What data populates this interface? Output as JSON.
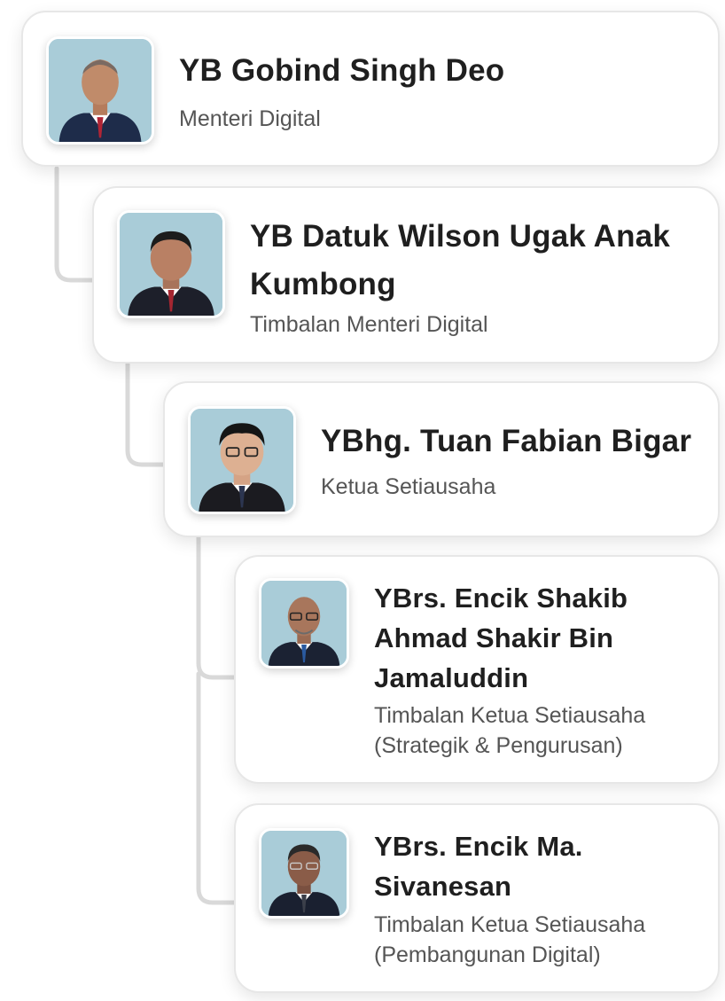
{
  "org_chart": [
    {
      "name": "YB Gobind Singh Deo",
      "role": "Menteri Digital",
      "avatar": "portrait-avatar"
    },
    {
      "name": "YB Datuk Wilson Ugak Anak Kumbong",
      "role": "Timbalan Menteri Digital",
      "avatar": "portrait-avatar"
    },
    {
      "name": "YBhg. Tuan Fabian Bigar",
      "role": "Ketua Setiausaha",
      "avatar": "portrait-avatar"
    },
    {
      "name": "YBrs. Encik Shakib Ahmad Shakir Bin Jamaluddin",
      "role": "Timbalan Ketua Setiausaha (Strategik & Pengurusan)",
      "avatar": "portrait-avatar"
    },
    {
      "name": "YBrs. Encik Ma. Sivanesan",
      "role": "Timbalan Ketua Setiausaha (Pembangunan Digital)",
      "avatar": "portrait-avatar"
    }
  ],
  "colors": {
    "photo_background": "#a9ccd8",
    "connector": "#d9d9d9",
    "card_border": "#e7e7e7"
  }
}
